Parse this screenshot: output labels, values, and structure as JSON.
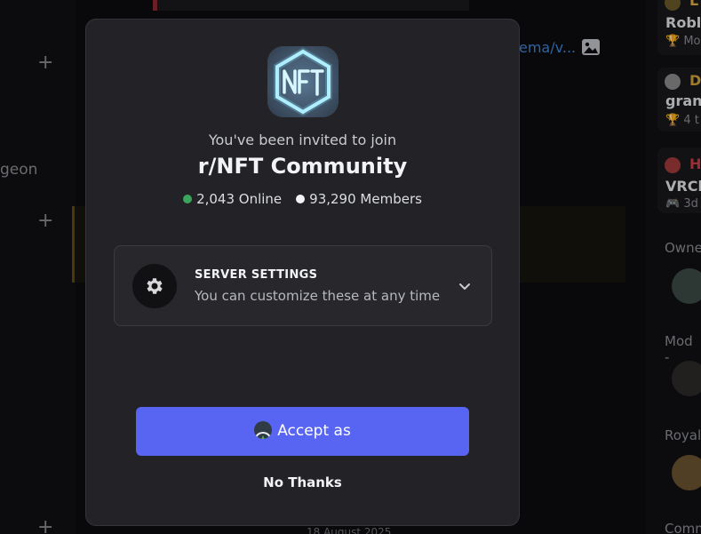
{
  "background": {
    "side_text": "geon",
    "link_text": "ema/v...",
    "date_text": "18 August 2025",
    "cards": [
      {
        "name_partial": "L",
        "title_partial": "Roblo",
        "sub_partial": "Mo",
        "sub_icon": "trophy-icon"
      },
      {
        "name_partial": "D",
        "title_partial": "grand",
        "sub_partial": "4 t",
        "sub_icon": "trophy-icon"
      },
      {
        "name_partial": "H",
        "title_partial": "VRCh",
        "sub_partial": "3d",
        "sub_icon": "gamepad-icon"
      }
    ],
    "member_groups": [
      "Owne",
      "Mod -",
      "Royal",
      "Comm"
    ]
  },
  "modal": {
    "invite_text": "You've been invited to join",
    "server_name": "r/NFT Community",
    "online_count": "2,043 Online",
    "member_count": "93,290 Members",
    "online_color": "#3ba55d",
    "server_icon": "nft-logo-icon",
    "settings": {
      "title": "SERVER SETTINGS",
      "subtitle": "You can customize these at any time",
      "icon": "gear-icon",
      "expand_icon": "chevron-down-icon"
    },
    "accept_label": "Accept as",
    "no_thanks_label": "No Thanks",
    "accent_color": "#5865f2"
  }
}
